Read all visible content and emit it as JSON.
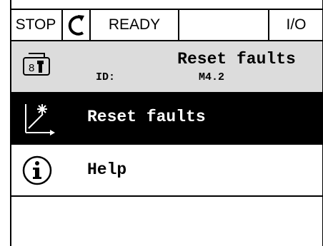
{
  "status_bar": {
    "stop_label": "STOP",
    "rotation_icon": "rotation-arrow-icon",
    "ready_label": "READY",
    "blank_label": "",
    "io_label": "I/O"
  },
  "header": {
    "title": "Reset faults",
    "id_label": "ID:",
    "id_value": "M4.2",
    "icon": "keypad-icon",
    "background_color": "#dcdcdc"
  },
  "menu": {
    "items": [
      {
        "label": "Reset faults",
        "icon": "reset-arrow-icon",
        "selected": true
      },
      {
        "label": "Help",
        "icon": "info-icon",
        "selected": false
      }
    ]
  },
  "colors": {
    "selected_bg": "#000000",
    "selected_text": "#ffffff",
    "text": "#000000"
  }
}
